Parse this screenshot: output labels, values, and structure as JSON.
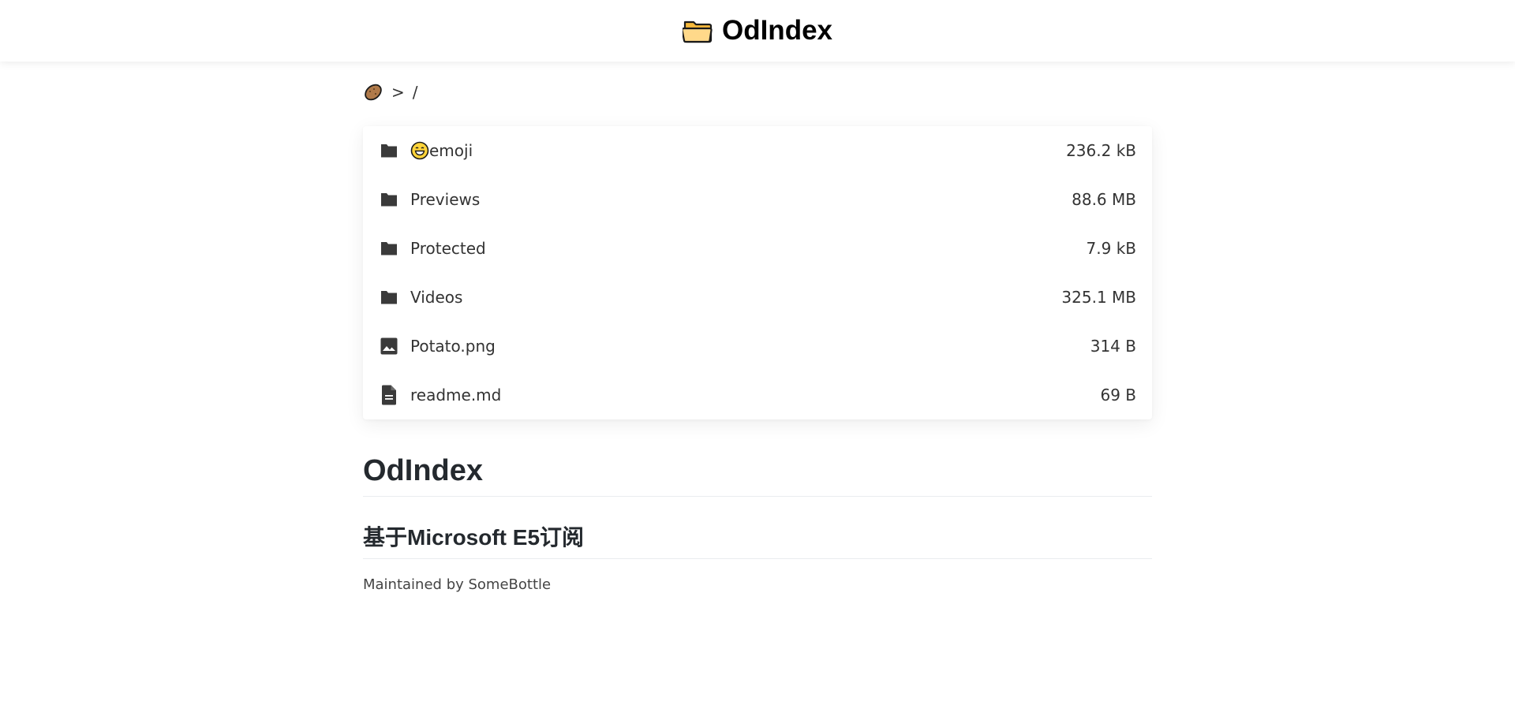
{
  "header": {
    "title": "OdIndex",
    "icon": "folder-icon"
  },
  "breadcrumb": {
    "home_icon": "potato-icon",
    "separator": ">",
    "path": "/"
  },
  "files": [
    {
      "name": "emoji",
      "prefix_emoji": "grinning-face-icon",
      "type": "folder",
      "size": "236.2 kB"
    },
    {
      "name": "Previews",
      "type": "folder",
      "size": "88.6 MB"
    },
    {
      "name": "Protected",
      "type": "folder",
      "size": "7.9 kB"
    },
    {
      "name": "Videos",
      "type": "folder",
      "size": "325.1 MB"
    },
    {
      "name": "Potato.png",
      "type": "image",
      "size": "314 B"
    },
    {
      "name": "readme.md",
      "type": "document",
      "size": "69 B"
    }
  ],
  "readme": {
    "heading": "OdIndex",
    "subheading": "基于Microsoft E5订阅",
    "text": "Maintained by SomeBottle"
  },
  "colors": {
    "icon": "#3a3a3a",
    "folder_emoji": "#ffd37a",
    "text": "#24292e"
  }
}
